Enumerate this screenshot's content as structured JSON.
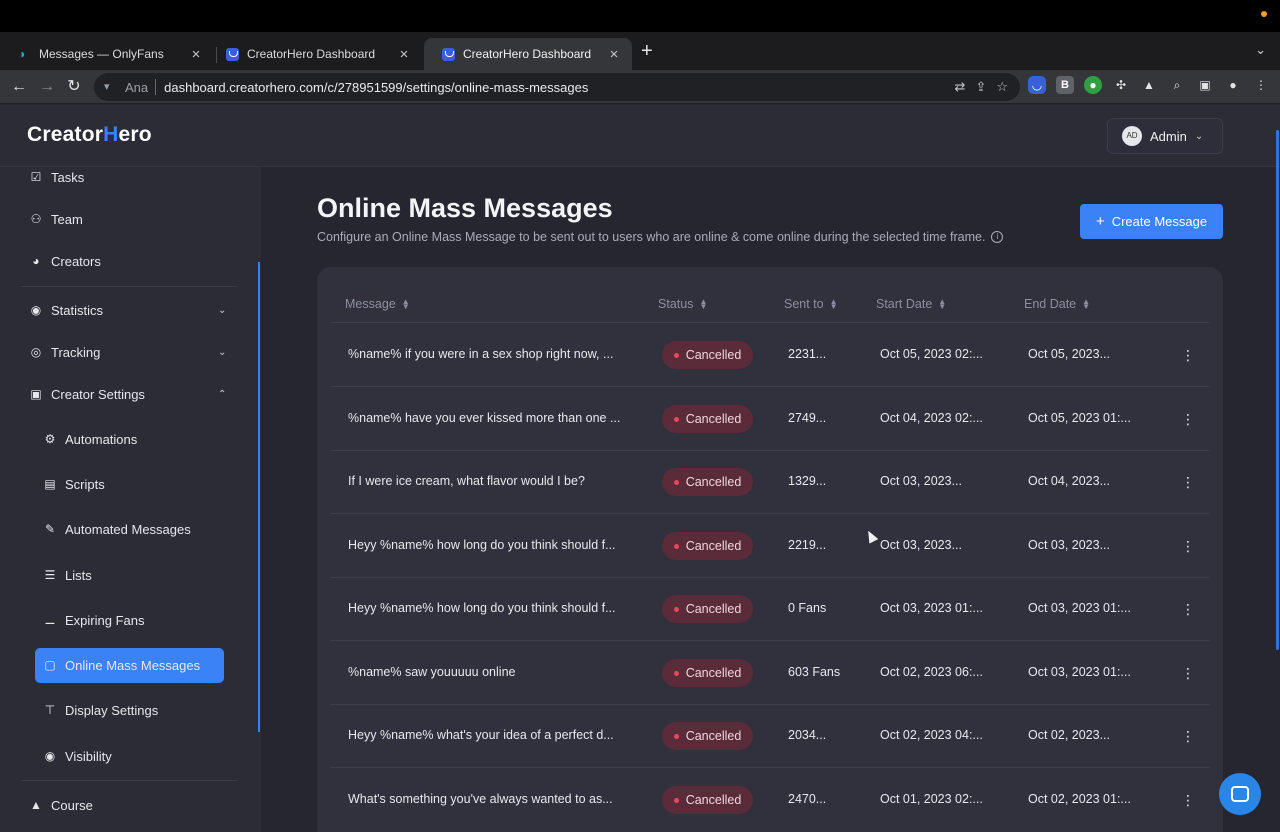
{
  "browser": {
    "tabs": [
      {
        "title": "Messages — OnlyFans",
        "favicon": "onlyfans-icon"
      },
      {
        "title": "CreatorHero Dashboard",
        "favicon": "creatorhero-icon"
      },
      {
        "title": "CreatorHero Dashboard",
        "favicon": "creatorhero-icon",
        "active": true
      }
    ],
    "profile_chip": "Ana",
    "url": "dashboard.creatorhero.com/c/278951599/settings/online-mass-messages"
  },
  "header": {
    "logo_prefix": "Creator",
    "logo_mark": "H",
    "logo_suffix": "ero",
    "user_initials": "AD",
    "user_label": "Admin"
  },
  "sidebar": {
    "items": [
      {
        "label": "Tasks",
        "icon": "clipboard-check-icon"
      },
      {
        "label": "Team",
        "icon": "team-icon"
      },
      {
        "label": "Creators",
        "icon": "palette-icon"
      },
      {
        "label": "Statistics",
        "icon": "eye-icon"
      },
      {
        "label": "Tracking",
        "icon": "tracking-icon"
      },
      {
        "label": "Creator Settings",
        "icon": "settings-box-icon"
      }
    ],
    "sub_items": [
      {
        "label": "Automations",
        "icon": "gears-icon"
      },
      {
        "label": "Scripts",
        "icon": "script-icon"
      },
      {
        "label": "Automated Messages",
        "icon": "message-edit-icon"
      },
      {
        "label": "Lists",
        "icon": "list-icon"
      },
      {
        "label": "Expiring Fans",
        "icon": "user-minus-icon"
      },
      {
        "label": "Online Mass Messages",
        "icon": "mass-message-icon",
        "active": true
      },
      {
        "label": "Display Settings",
        "icon": "paint-roller-icon"
      },
      {
        "label": "Visibility",
        "icon": "eye-icon"
      }
    ],
    "footer_item": {
      "label": "Course",
      "icon": "graduation-cap-icon"
    }
  },
  "page": {
    "title": "Online Mass Messages",
    "subtitle": "Configure an Online Mass Message to be sent out to users who are online & come online during the selected time frame.",
    "create_button": "Create Message"
  },
  "table": {
    "columns": [
      "Message",
      "Status",
      "Sent to",
      "Start Date",
      "End Date"
    ],
    "rows": [
      {
        "message": "%name% if you were in a sex shop right now, ...",
        "status": "Cancelled",
        "sent_to": "2231...",
        "start": "Oct 05, 2023 02:...",
        "end": "Oct 05, 2023..."
      },
      {
        "message": "%name% have you ever kissed more than one ...",
        "status": "Cancelled",
        "sent_to": "2749...",
        "start": "Oct 04, 2023 02:...",
        "end": "Oct 05, 2023 01:..."
      },
      {
        "message": "If I were ice cream, what flavor would I be?",
        "status": "Cancelled",
        "sent_to": "1329...",
        "start": "Oct 03, 2023...",
        "end": "Oct 04, 2023..."
      },
      {
        "message": "Heyy %name% how long do you think should f...",
        "status": "Cancelled",
        "sent_to": "2219...",
        "start": "Oct 03, 2023...",
        "end": "Oct 03, 2023..."
      },
      {
        "message": "Heyy %name% how long do you think should f...",
        "status": "Cancelled",
        "sent_to": "0 Fans",
        "start": "Oct 03, 2023 01:...",
        "end": "Oct 03, 2023 01:..."
      },
      {
        "message": "%name% saw youuuuu online",
        "status": "Cancelled",
        "sent_to": "603 Fans",
        "start": "Oct 02, 2023 06:...",
        "end": "Oct 03, 2023 01:..."
      },
      {
        "message": "Heyy %name% what's your idea of a perfect d...",
        "status": "Cancelled",
        "sent_to": "2034...",
        "start": "Oct 02, 2023 04:...",
        "end": "Oct 02, 2023..."
      },
      {
        "message": "What's something you've always wanted to as...",
        "status": "Cancelled",
        "sent_to": "2470...",
        "start": "Oct 01, 2023 02:...",
        "end": "Oct 02, 2023 01:..."
      }
    ]
  },
  "colors": {
    "accent": "#3b82f6",
    "status_cancelled_bg": "#5a2b38",
    "status_cancelled_dot": "#f0455f"
  }
}
